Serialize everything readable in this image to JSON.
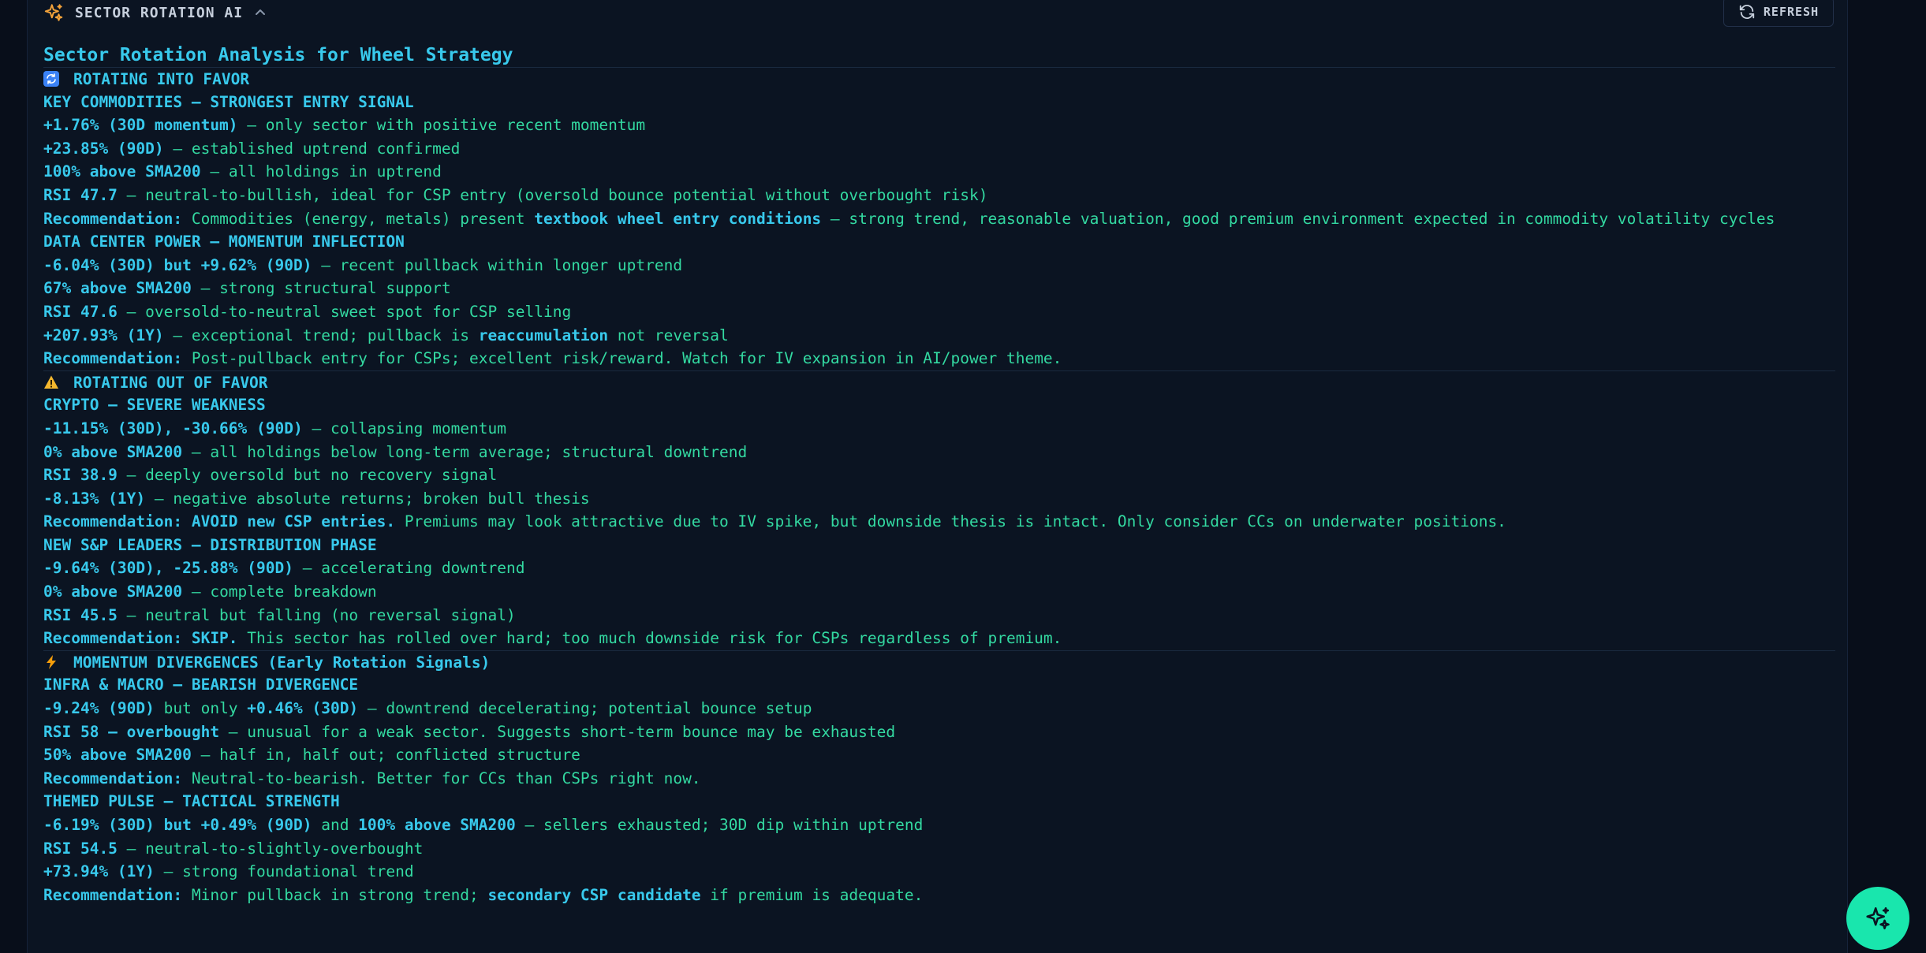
{
  "header": {
    "title": "SECTOR ROTATION AI",
    "refresh_label": "REFRESH",
    "icons": {
      "brand": "sparkle-icon",
      "collapse": "chevron-up-icon",
      "refresh": "refresh-icon"
    }
  },
  "colors": {
    "accent": "#38c9ec",
    "body_text": "#33d9a1",
    "background": "#0b1422",
    "fab": "#19e6ad"
  },
  "report": {
    "title": "Sector Rotation Analysis for Wheel Strategy",
    "sections": [
      {
        "icon": "rotate-arrows-icon",
        "heading": "ROTATING INTO FAVOR",
        "sectors": [
          {
            "heading": "KEY COMMODITIES — STRONGEST ENTRY SIGNAL",
            "lines": [
              [
                {
                  "b": "+1.76% (30D momentum)"
                },
                {
                  "t": " — only sector with positive recent momentum"
                }
              ],
              [
                {
                  "b": "+23.85% (90D)"
                },
                {
                  "t": " — established uptrend confirmed"
                }
              ],
              [
                {
                  "b": "100% above SMA200"
                },
                {
                  "t": " — all holdings in uptrend"
                }
              ],
              [
                {
                  "b": "RSI 47.7"
                },
                {
                  "t": " — neutral-to-bullish, ideal for CSP entry (oversold bounce potential without overbought risk)"
                }
              ],
              [
                {
                  "b": "Recommendation:"
                },
                {
                  "t": " Commodities (energy, metals) present "
                },
                {
                  "b": "textbook wheel entry conditions"
                },
                {
                  "t": " — strong trend, reasonable valuation, good premium environment expected in commodity volatility cycles"
                }
              ]
            ]
          },
          {
            "heading": "DATA CENTER POWER — MOMENTUM INFLECTION",
            "lines": [
              [
                {
                  "b": "-6.04% (30D) but +9.62% (90D)"
                },
                {
                  "t": " — recent pullback within longer uptrend"
                }
              ],
              [
                {
                  "b": "67% above SMA200"
                },
                {
                  "t": " — strong structural support"
                }
              ],
              [
                {
                  "b": "RSI 47.6"
                },
                {
                  "t": " — oversold-to-neutral sweet spot for CSP selling"
                }
              ],
              [
                {
                  "b": "+207.93% (1Y)"
                },
                {
                  "t": " — exceptional trend; pullback is "
                },
                {
                  "b": "reaccumulation"
                },
                {
                  "t": " not reversal"
                }
              ],
              [
                {
                  "b": "Recommendation:"
                },
                {
                  "t": " Post-pullback entry for CSPs; excellent risk/reward. Watch for IV expansion in AI/power theme."
                }
              ]
            ]
          }
        ]
      },
      {
        "icon": "warning-icon",
        "heading": "ROTATING OUT OF FAVOR",
        "sectors": [
          {
            "heading": "CRYPTO — SEVERE WEAKNESS",
            "lines": [
              [
                {
                  "b": "-11.15% (30D), -30.66% (90D)"
                },
                {
                  "t": " — collapsing momentum"
                }
              ],
              [
                {
                  "b": "0% above SMA200"
                },
                {
                  "t": " — all holdings below long-term average; structural downtrend"
                }
              ],
              [
                {
                  "b": "RSI 38.9"
                },
                {
                  "t": " — deeply oversold but no recovery signal"
                }
              ],
              [
                {
                  "b": "-8.13% (1Y)"
                },
                {
                  "t": " — negative absolute returns; broken bull thesis"
                }
              ],
              [
                {
                  "b": "Recommendation: AVOID new CSP entries."
                },
                {
                  "t": " Premiums may look attractive due to IV spike, but downside thesis is intact. Only consider CCs on underwater positions."
                }
              ]
            ]
          },
          {
            "heading": "NEW S&P LEADERS — DISTRIBUTION PHASE",
            "lines": [
              [
                {
                  "b": "-9.64% (30D), -25.88% (90D)"
                },
                {
                  "t": " — accelerating downtrend"
                }
              ],
              [
                {
                  "b": "0% above SMA200"
                },
                {
                  "t": " — complete breakdown"
                }
              ],
              [
                {
                  "b": "RSI 45.5"
                },
                {
                  "t": " — neutral but falling (no reversal signal)"
                }
              ],
              [
                {
                  "b": "Recommendation: SKIP."
                },
                {
                  "t": " This sector has rolled over hard; too much downside risk for CSPs regardless of premium."
                }
              ]
            ]
          }
        ]
      },
      {
        "icon": "lightning-icon",
        "heading": "MOMENTUM DIVERGENCES (Early Rotation Signals)",
        "sectors": [
          {
            "heading": "INFRA & MACRO — BEARISH DIVERGENCE",
            "lines": [
              [
                {
                  "b": "-9.24% (90D)"
                },
                {
                  "t": " but only "
                },
                {
                  "b": "+0.46% (30D)"
                },
                {
                  "t": " — downtrend decelerating; potential bounce setup"
                }
              ],
              [
                {
                  "b": "RSI 58 — overbought"
                },
                {
                  "t": " — unusual for a weak sector. Suggests short-term bounce may be exhausted"
                }
              ],
              [
                {
                  "b": "50% above SMA200"
                },
                {
                  "t": " — half in, half out; conflicted structure"
                }
              ],
              [
                {
                  "b": "Recommendation:"
                },
                {
                  "t": " Neutral-to-bearish. Better for CCs than CSPs right now."
                }
              ]
            ]
          },
          {
            "heading": "THEMED PULSE — TACTICAL STRENGTH",
            "lines": [
              [
                {
                  "b": "-6.19% (30D) but +0.49% (90D)"
                },
                {
                  "t": " and "
                },
                {
                  "b": "100% above SMA200"
                },
                {
                  "t": " — sellers exhausted; 30D dip within uptrend"
                }
              ],
              [
                {
                  "b": "RSI 54.5"
                },
                {
                  "t": " — neutral-to-slightly-overbought"
                }
              ],
              [
                {
                  "b": "+73.94% (1Y)"
                },
                {
                  "t": " — strong foundational trend"
                }
              ],
              [
                {
                  "b": "Recommendation:"
                },
                {
                  "t": " Minor pullback in strong trend; "
                },
                {
                  "b": "secondary CSP candidate"
                },
                {
                  "t": " if premium is adequate."
                }
              ]
            ]
          }
        ]
      }
    ]
  },
  "fab": {
    "icon": "sparkle-icon"
  }
}
